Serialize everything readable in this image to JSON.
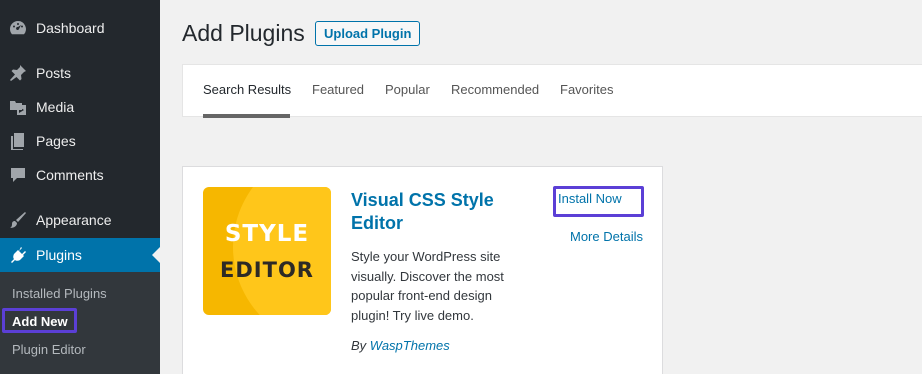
{
  "sidebar": {
    "items": [
      {
        "label": "Dashboard",
        "icon": "dashboard-icon"
      },
      {
        "label": "Posts",
        "icon": "pushpin-icon"
      },
      {
        "label": "Media",
        "icon": "media-icon"
      },
      {
        "label": "Pages",
        "icon": "pages-icon"
      },
      {
        "label": "Comments",
        "icon": "comment-icon"
      },
      {
        "label": "Appearance",
        "icon": "paintbrush-icon"
      },
      {
        "label": "Plugins",
        "icon": "plugin-icon"
      }
    ],
    "submenu": [
      "Installed Plugins",
      "Add New",
      "Plugin Editor"
    ],
    "active_color": "#0073aa"
  },
  "header": {
    "title": "Add Plugins",
    "upload_label": "Upload Plugin"
  },
  "tabs": [
    "Search Results",
    "Featured",
    "Popular",
    "Recommended",
    "Favorites"
  ],
  "plugin": {
    "icon_line1": "STYLE",
    "icon_line2": "EDITOR",
    "name": "Visual CSS Style Editor",
    "description": "Style your WordPress site visually. Discover the most popular front-end design plugin! Try live demo.",
    "author_prefix": "By",
    "author": "WaspThemes",
    "install_label": "Install Now",
    "details_label": "More Details"
  },
  "highlight_color": "#5b3fd6"
}
